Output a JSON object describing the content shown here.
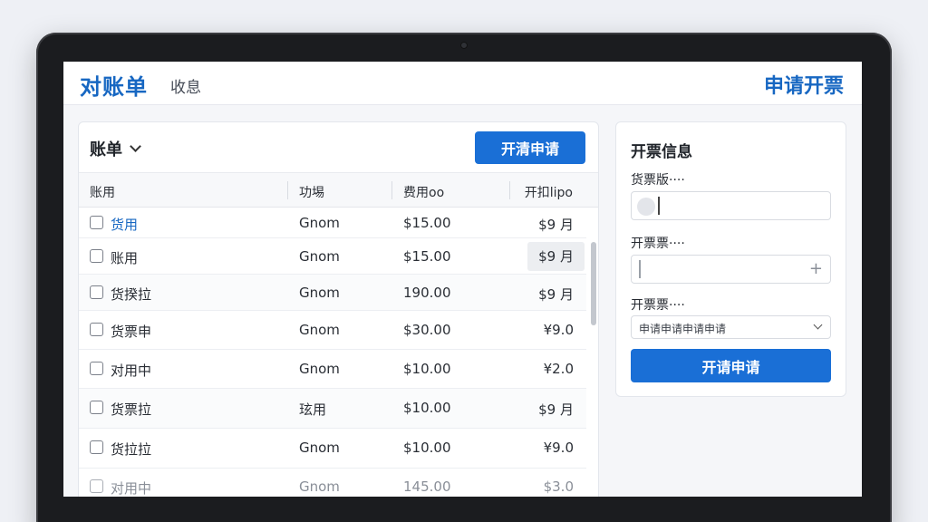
{
  "header": {
    "title": "对账单",
    "tab": "收息",
    "action": "申请开票"
  },
  "bill": {
    "select_label": "账单",
    "apply_button": "开清申请",
    "columns": [
      "账用",
      "功埸",
      "费用oo",
      "开扣lipo"
    ],
    "rows": [
      {
        "name": "货用",
        "type": "Gnom",
        "amount": "$15.00",
        "fee": "$9 月"
      },
      {
        "name": "账用",
        "type": "Gnom",
        "amount": "$15.00",
        "fee": "$9 月"
      },
      {
        "name": "货揆拉",
        "type": "Gnom",
        "amount": "190.00",
        "fee": "$9 月"
      },
      {
        "name": "货票申",
        "type": "Gnom",
        "amount": "$30.00",
        "fee": "¥9.0"
      },
      {
        "name": "对用中",
        "type": "Gnom",
        "amount": "$10.00",
        "fee": "¥2.0"
      },
      {
        "name": "货票拉",
        "type": "玹用",
        "amount": "$10.00",
        "fee": "$9 月"
      },
      {
        "name": "货拉拉",
        "type": "Gnom",
        "amount": "$10.00",
        "fee": "¥9.0"
      },
      {
        "name": "对用中",
        "type": "Gnom",
        "amount": "145.00",
        "fee": "$3.0"
      }
    ]
  },
  "invoice": {
    "title": "开票信息",
    "field1_label": "货票版····",
    "field2_label": "开票票····",
    "field3_label": "开票票····",
    "field3_value": "申请申请申请申请",
    "submit": "开请申请"
  },
  "colors": {
    "accent": "#1a6fd6",
    "title": "#1767c2"
  }
}
